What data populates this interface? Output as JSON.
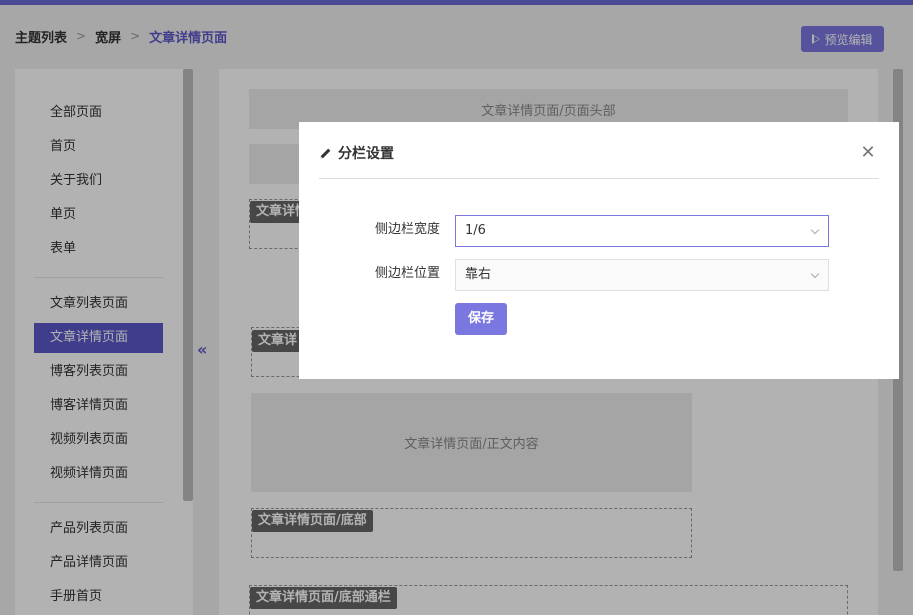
{
  "breadcrumb": [
    "主题列表",
    "宽屏",
    "文章详情页面"
  ],
  "header": {
    "preview_label": "预览编辑"
  },
  "sidebar": {
    "group1": [
      "全部页面",
      "首页",
      "关于我们",
      "单页",
      "表单"
    ],
    "group2": [
      "文章列表页面",
      "文章详情页面",
      "博客列表页面",
      "博客详情页面",
      "视频列表页面",
      "视频详情页面"
    ],
    "group3": [
      "产品列表页面",
      "产品详情页面",
      "手册首页"
    ],
    "active": "文章详情页面",
    "collapse_glyph": "«"
  },
  "canvas": {
    "header_block": "文章详情页面/页面头部",
    "tag_1": "文章详情",
    "tag_2": "文章详",
    "body_block": "文章详情页面/正文内容",
    "footer_tag": "文章详情页面/底部",
    "bottom_bar_tag": "文章详情页面/底部通栏"
  },
  "modal": {
    "title": "分栏设置",
    "title_icon": "pencil-icon",
    "fields": [
      {
        "label": "侧边栏宽度",
        "value": "1/6"
      },
      {
        "label": "侧边栏位置",
        "value": "靠右"
      }
    ],
    "save_label": "保存",
    "close_glyph": "✕"
  },
  "colors": {
    "accent": "#5c58c9",
    "button": "#7b77e0"
  }
}
